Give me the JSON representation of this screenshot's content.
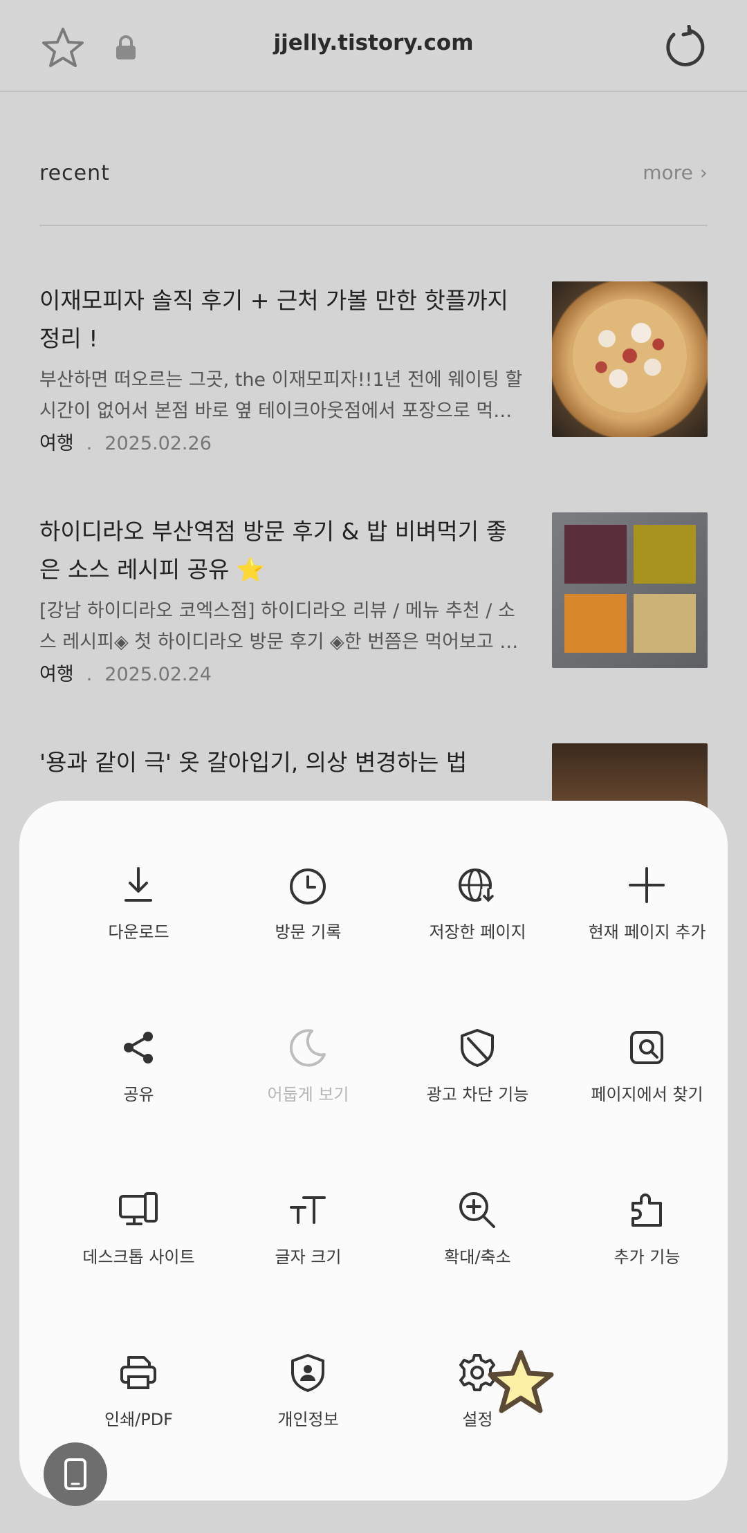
{
  "browser": {
    "url": "jjelly.tistory.com",
    "icons": {
      "bookmark": "star-outline-icon",
      "lock": "lock-icon",
      "reload": "reload-icon"
    }
  },
  "section": {
    "title": "recent",
    "more_label": "more"
  },
  "posts": [
    {
      "title": "이재모피자 솔직 후기 + 근처 가볼 만한 핫플까지 정리 !",
      "description": "부산하면 떠오르는 그곳, the 이재모피자!!1년 전에 웨이팅 할 시간이 없어서 본점 바로 옆 테이크아웃점에서 포장으로 먹…",
      "category": "여행",
      "date": "2025.02.26"
    },
    {
      "title": "하이디라오 부산역점 방문 후기 & 밥 비벼먹기 좋은 소스 레시피 공유 ⭐",
      "description": "[강남 하이디라오 코엑스점] 하이디라오 리뷰 / 메뉴 추천 / 소스 레시피◈ 첫 하이디라오 방문 후기 ◈한 번쯤은 먹어보고 …",
      "category": "여행",
      "date": "2025.02.24"
    },
    {
      "title": "'용과 같이 극' 옷 갈아입기, 의상 변경하는 법"
    }
  ],
  "menu": {
    "items": [
      {
        "label": "다운로드",
        "icon": "download-icon"
      },
      {
        "label": "방문 기록",
        "icon": "history-clock-icon"
      },
      {
        "label": "저장한 페이지",
        "icon": "saved-pages-globe-icon"
      },
      {
        "label": "현재 페이지 추가",
        "icon": "plus-icon"
      },
      {
        "label": "공유",
        "icon": "share-icon"
      },
      {
        "label": "어둡게 보기",
        "icon": "moon-icon",
        "disabled": true
      },
      {
        "label": "광고 차단 기능",
        "icon": "ad-block-shield-icon"
      },
      {
        "label": "페이지에서 찾기",
        "icon": "find-in-page-icon"
      },
      {
        "label": "데스크톱 사이트",
        "icon": "desktop-icon"
      },
      {
        "label": "글자 크기",
        "icon": "text-size-icon"
      },
      {
        "label": "확대/축소",
        "icon": "zoom-in-icon"
      },
      {
        "label": "추가 기능",
        "icon": "add-ons-puzzle-icon"
      },
      {
        "label": "인쇄/PDF",
        "icon": "print-icon"
      },
      {
        "label": "개인정보",
        "icon": "privacy-shield-icon"
      },
      {
        "label": "설정",
        "icon": "settings-gear-icon"
      }
    ]
  },
  "colors": {
    "sheet": "#fbfbfb",
    "dim_background": "#d4d4d4",
    "accent_star": "#fbf0a5"
  }
}
